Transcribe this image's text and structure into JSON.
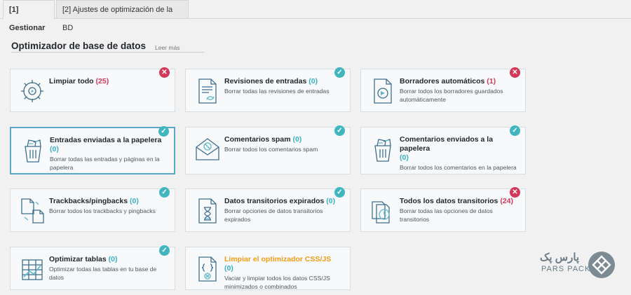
{
  "tabs": [
    {
      "label": "[1] Gestionar"
    },
    {
      "label": "[2] Ajustes de optimización de la BD"
    }
  ],
  "section": {
    "title": "Optimizador de base de datos",
    "read_more": "Leer más"
  },
  "cards": [
    {
      "title": "Limpiar todo",
      "count": "(25)",
      "count_status": "bad",
      "desc": "",
      "status": "bad",
      "icon": "gears-icon"
    },
    {
      "title": "Revisiones de entradas",
      "count": "(0)",
      "count_status": "ok",
      "desc": "Borrar todas las revisiones de entradas",
      "status": "ok",
      "icon": "document-revision-icon"
    },
    {
      "title": "Borradores automáticos",
      "count": "(1)",
      "count_status": "bad",
      "desc": "Borrar todos los borradores guardados automáticamente",
      "status": "bad",
      "icon": "document-gear-icon"
    },
    {
      "title": "Entradas enviadas a la papelera",
      "count": "(0)",
      "count_status": "ok",
      "desc": "Borrar todas las entradas y páginas en la papelera",
      "status": "ok",
      "icon": "trash-bin-icon"
    },
    {
      "title": "Comentarios spam",
      "count": "(0)",
      "count_status": "ok",
      "desc": "Borrar todos los comentarios spam",
      "status": "ok",
      "icon": "spam-envelope-icon"
    },
    {
      "title": "Comentarios enviados a la papelera",
      "count": "(0)",
      "count_status": "ok",
      "desc": "Borrar todos los comentarios en la papelera",
      "status": "ok",
      "icon": "trash-bin-icon"
    },
    {
      "title": "Trackbacks/pingbacks",
      "count": "(0)",
      "count_status": "ok",
      "desc": "Borrar todos los trackbacks y pingbacks",
      "status": "ok",
      "icon": "linked-documents-icon"
    },
    {
      "title": "Datos transitorios expirados",
      "count": "(0)",
      "count_status": "ok",
      "desc": "Borrar opciones de datos transitorios expirados",
      "status": "ok",
      "icon": "hourglass-document-icon"
    },
    {
      "title": "Todos los datos transitorios",
      "count": "(24)",
      "count_status": "bad",
      "desc": "Borrar todas las opciones de datos transitorios",
      "status": "bad",
      "icon": "clock-documents-icon"
    },
    {
      "title": "Optimizar tablas",
      "count": "(0)",
      "count_status": "ok",
      "desc": "Optimizar todas las tablas en tu base de datos",
      "status": "ok",
      "icon": "table-chart-icon"
    },
    {
      "title": "Limpiar el optimizador CSS/JS",
      "count": "(0)",
      "count_status": "ok",
      "desc": "Vaciar y limpiar todos los datos CSS/JS minimizados o combinados",
      "status": "",
      "icon": "code-file-icon"
    }
  ],
  "brand": {
    "name_fa": "پارس پک",
    "name_en": "PARS PACK"
  }
}
